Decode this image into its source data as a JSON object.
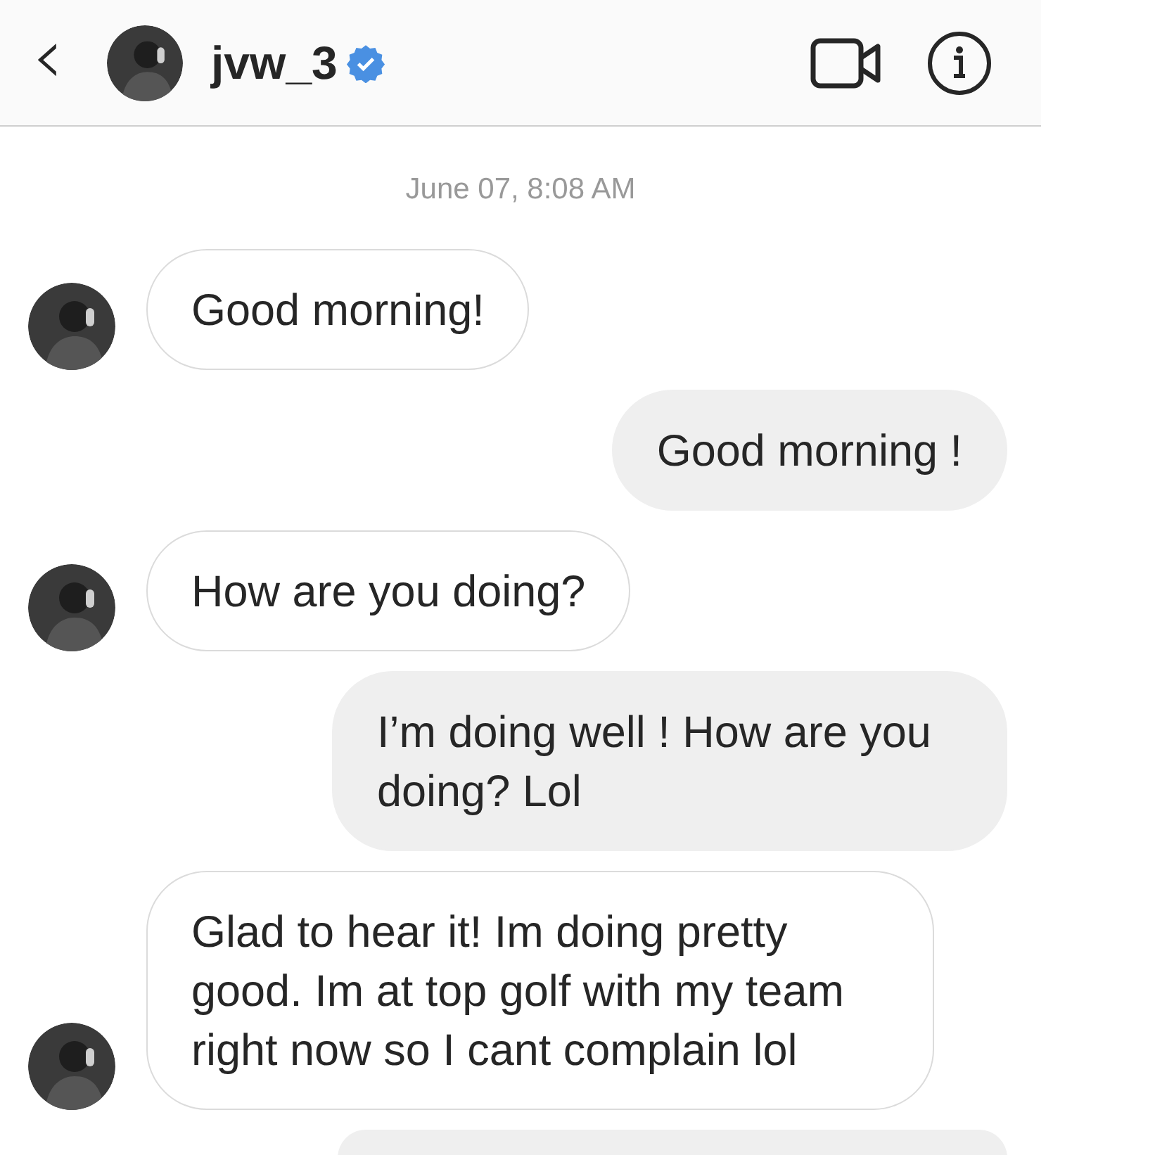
{
  "header": {
    "back": "‹",
    "username": "jvw_3",
    "verified": true
  },
  "timestamp": "June 07, 8:08 AM",
  "messages": [
    {
      "kind": "received",
      "text": "Good morning!"
    },
    {
      "kind": "sent",
      "text": "Good morning !"
    },
    {
      "kind": "received",
      "text": "How are you doing?"
    },
    {
      "kind": "sent",
      "text": "I’m doing well ! How are you doing? Lol"
    },
    {
      "kind": "received",
      "text": "Glad to hear it! Im doing pretty good. Im at top golf with my team right now so I cant complain lol"
    }
  ],
  "cut_off_bubble": {
    "kind": "sent"
  }
}
